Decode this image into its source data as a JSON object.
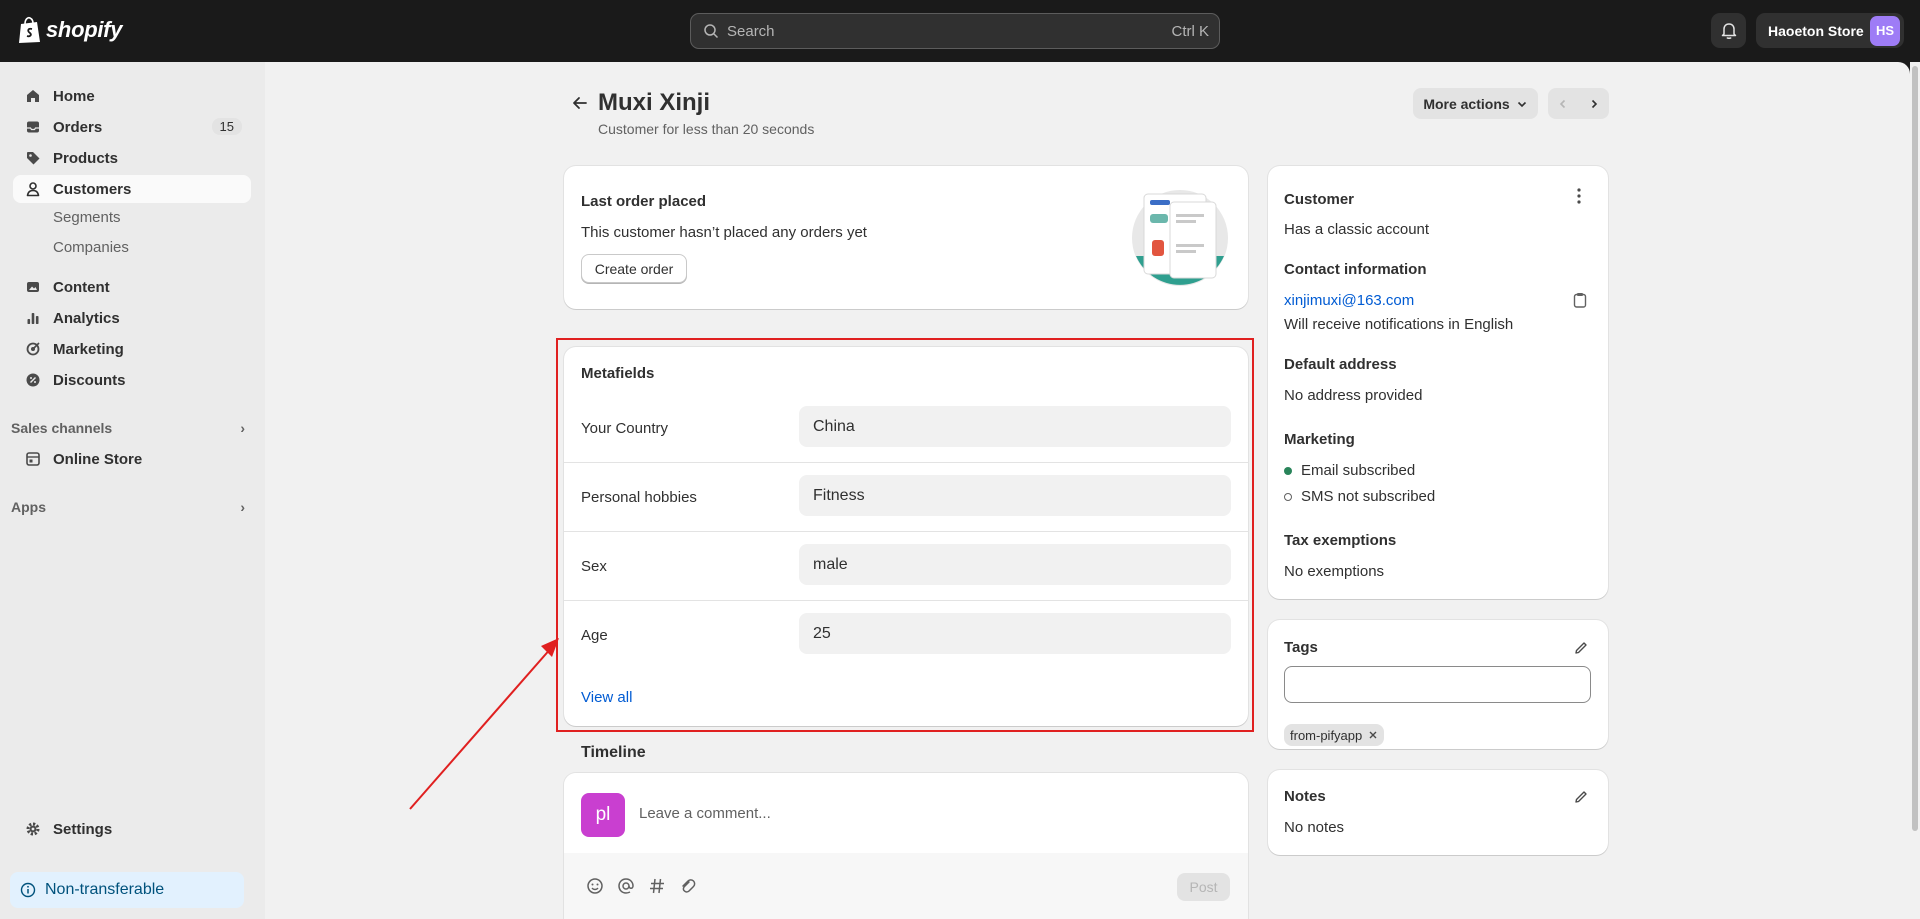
{
  "topbar": {
    "brand": "shopify",
    "search_placeholder": "Search",
    "search_shortcut": "Ctrl K",
    "store_name": "Haoeton Store",
    "store_initials": "HS"
  },
  "sidebar": {
    "home": "Home",
    "orders": "Orders",
    "orders_count": "15",
    "products": "Products",
    "customers": "Customers",
    "segments": "Segments",
    "companies": "Companies",
    "content": "Content",
    "analytics": "Analytics",
    "marketing": "Marketing",
    "discounts": "Discounts",
    "sales_channels": "Sales channels",
    "online_store": "Online Store",
    "apps": "Apps",
    "settings": "Settings",
    "non_transferable": "Non-transferable"
  },
  "page": {
    "title": "Muxi Xinji",
    "subtitle": "Customer for less than 20 seconds",
    "more_actions": "More actions"
  },
  "last_order": {
    "title": "Last order placed",
    "text": "This customer hasn’t placed any orders yet",
    "button": "Create order"
  },
  "metafields": {
    "title": "Metafields",
    "rows": [
      {
        "label": "Your Country",
        "value": "China"
      },
      {
        "label": "Personal hobbies",
        "value": "Fitness"
      },
      {
        "label": "Sex",
        "value": "male"
      },
      {
        "label": "Age",
        "value": "25"
      }
    ],
    "view_all": "View all"
  },
  "timeline": {
    "title": "Timeline",
    "avatar": "pl",
    "placeholder": "Leave a comment...",
    "post": "Post"
  },
  "customer_card": {
    "title": "Customer",
    "account": "Has a classic account",
    "contact_title": "Contact information",
    "email": "xinjimuxi@163.com",
    "notifications": "Will receive notifications in English",
    "address_title": "Default address",
    "address": "No address provided",
    "marketing_title": "Marketing",
    "email_status": "Email subscribed",
    "sms_status": "SMS not subscribed",
    "tax_title": "Tax exemptions",
    "tax": "No exemptions"
  },
  "tags": {
    "title": "Tags",
    "chips": [
      "from-pifyapp"
    ]
  },
  "notes": {
    "title": "Notes",
    "text": "No notes"
  },
  "colors": {
    "accent_link": "#005bd3",
    "annotation_red": "#e02020",
    "avatar_purple": "#c93fd0",
    "subscribed_green": "#29845a"
  }
}
